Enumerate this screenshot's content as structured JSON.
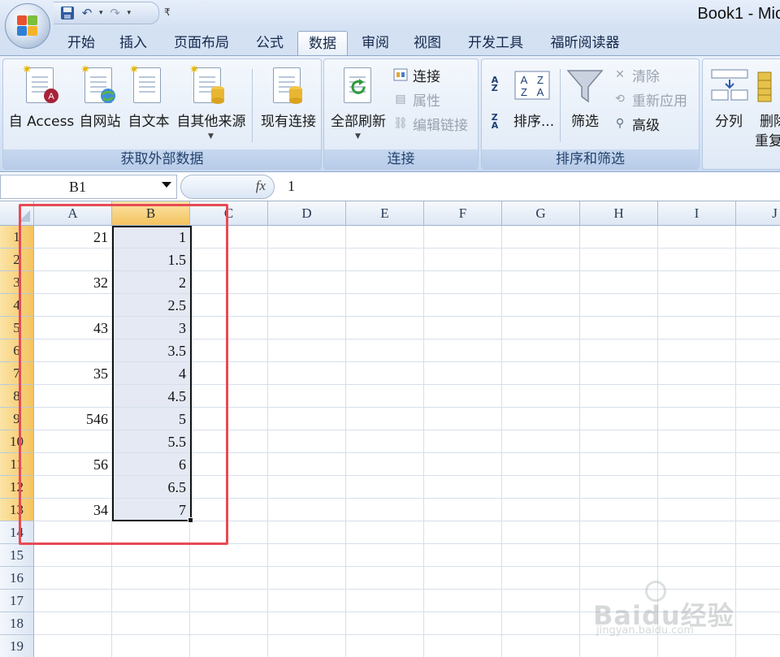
{
  "window": {
    "title": "Book1 - Mic"
  },
  "quick_access": {
    "save_icon": "save-icon",
    "undo_icon": "undo-icon",
    "redo_icon": "redo-icon",
    "more": "₹"
  },
  "tabs": [
    {
      "label": "开始"
    },
    {
      "label": "插入"
    },
    {
      "label": "页面布局"
    },
    {
      "label": "公式"
    },
    {
      "label": "数据",
      "active": true
    },
    {
      "label": "审阅"
    },
    {
      "label": "视图"
    },
    {
      "label": "开发工具"
    },
    {
      "label": "福昕阅读器"
    }
  ],
  "ribbon": {
    "external": {
      "label": "获取外部数据",
      "access": "自 Access",
      "web": "自网站",
      "text": "自文本",
      "other": "自其他来源",
      "existing": "现有连接"
    },
    "connections": {
      "label": "连接",
      "refresh_all": "全部刷新",
      "connections": "连接",
      "properties": "属性",
      "edit_links": "编辑链接"
    },
    "sort_filter": {
      "label": "排序和筛选",
      "sort": "排序...",
      "filter": "筛选",
      "clear": "清除",
      "reapply": "重新应用",
      "advanced": "高级"
    },
    "tools": {
      "split": "分列",
      "remove_dup_1": "删除",
      "remove_dup_2": "重复"
    }
  },
  "formula_bar": {
    "name_box": "B1",
    "fx": "fx",
    "value": "1"
  },
  "sheet": {
    "columns": [
      "A",
      "B",
      "C",
      "D",
      "E",
      "F",
      "G",
      "H",
      "I",
      "J"
    ],
    "rows": [
      "1",
      "2",
      "3",
      "4",
      "5",
      "6",
      "7",
      "8",
      "9",
      "10",
      "11",
      "12",
      "13",
      "14",
      "15",
      "16",
      "17",
      "18",
      "19"
    ],
    "colA": [
      "21",
      "",
      "32",
      "",
      "43",
      "",
      "35",
      "",
      "546",
      "",
      "56",
      "",
      "34"
    ],
    "colB": [
      "1",
      "1.5",
      "2",
      "2.5",
      "3",
      "3.5",
      "4",
      "4.5",
      "5",
      "5.5",
      "6",
      "6.5",
      "7"
    ]
  },
  "watermark": {
    "word": "Baidu经验",
    "sub": "jingyan.baidu.com"
  }
}
